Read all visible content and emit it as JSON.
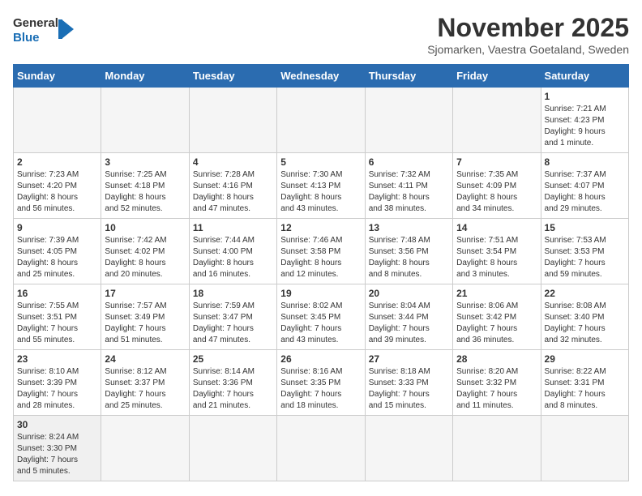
{
  "header": {
    "logo_general": "General",
    "logo_blue": "Blue",
    "month_title": "November 2025",
    "subtitle": "Sjomarken, Vaestra Goetaland, Sweden"
  },
  "weekdays": [
    "Sunday",
    "Monday",
    "Tuesday",
    "Wednesday",
    "Thursday",
    "Friday",
    "Saturday"
  ],
  "days": [
    {
      "day": "",
      "info": ""
    },
    {
      "day": "",
      "info": ""
    },
    {
      "day": "",
      "info": ""
    },
    {
      "day": "",
      "info": ""
    },
    {
      "day": "",
      "info": ""
    },
    {
      "day": "",
      "info": ""
    },
    {
      "day": "1",
      "info": "Sunrise: 7:21 AM\nSunset: 4:23 PM\nDaylight: 9 hours\nand 1 minute."
    },
    {
      "day": "2",
      "info": "Sunrise: 7:23 AM\nSunset: 4:20 PM\nDaylight: 8 hours\nand 56 minutes."
    },
    {
      "day": "3",
      "info": "Sunrise: 7:25 AM\nSunset: 4:18 PM\nDaylight: 8 hours\nand 52 minutes."
    },
    {
      "day": "4",
      "info": "Sunrise: 7:28 AM\nSunset: 4:16 PM\nDaylight: 8 hours\nand 47 minutes."
    },
    {
      "day": "5",
      "info": "Sunrise: 7:30 AM\nSunset: 4:13 PM\nDaylight: 8 hours\nand 43 minutes."
    },
    {
      "day": "6",
      "info": "Sunrise: 7:32 AM\nSunset: 4:11 PM\nDaylight: 8 hours\nand 38 minutes."
    },
    {
      "day": "7",
      "info": "Sunrise: 7:35 AM\nSunset: 4:09 PM\nDaylight: 8 hours\nand 34 minutes."
    },
    {
      "day": "8",
      "info": "Sunrise: 7:37 AM\nSunset: 4:07 PM\nDaylight: 8 hours\nand 29 minutes."
    },
    {
      "day": "9",
      "info": "Sunrise: 7:39 AM\nSunset: 4:05 PM\nDaylight: 8 hours\nand 25 minutes."
    },
    {
      "day": "10",
      "info": "Sunrise: 7:42 AM\nSunset: 4:02 PM\nDaylight: 8 hours\nand 20 minutes."
    },
    {
      "day": "11",
      "info": "Sunrise: 7:44 AM\nSunset: 4:00 PM\nDaylight: 8 hours\nand 16 minutes."
    },
    {
      "day": "12",
      "info": "Sunrise: 7:46 AM\nSunset: 3:58 PM\nDaylight: 8 hours\nand 12 minutes."
    },
    {
      "day": "13",
      "info": "Sunrise: 7:48 AM\nSunset: 3:56 PM\nDaylight: 8 hours\nand 8 minutes."
    },
    {
      "day": "14",
      "info": "Sunrise: 7:51 AM\nSunset: 3:54 PM\nDaylight: 8 hours\nand 3 minutes."
    },
    {
      "day": "15",
      "info": "Sunrise: 7:53 AM\nSunset: 3:53 PM\nDaylight: 7 hours\nand 59 minutes."
    },
    {
      "day": "16",
      "info": "Sunrise: 7:55 AM\nSunset: 3:51 PM\nDaylight: 7 hours\nand 55 minutes."
    },
    {
      "day": "17",
      "info": "Sunrise: 7:57 AM\nSunset: 3:49 PM\nDaylight: 7 hours\nand 51 minutes."
    },
    {
      "day": "18",
      "info": "Sunrise: 7:59 AM\nSunset: 3:47 PM\nDaylight: 7 hours\nand 47 minutes."
    },
    {
      "day": "19",
      "info": "Sunrise: 8:02 AM\nSunset: 3:45 PM\nDaylight: 7 hours\nand 43 minutes."
    },
    {
      "day": "20",
      "info": "Sunrise: 8:04 AM\nSunset: 3:44 PM\nDaylight: 7 hours\nand 39 minutes."
    },
    {
      "day": "21",
      "info": "Sunrise: 8:06 AM\nSunset: 3:42 PM\nDaylight: 7 hours\nand 36 minutes."
    },
    {
      "day": "22",
      "info": "Sunrise: 8:08 AM\nSunset: 3:40 PM\nDaylight: 7 hours\nand 32 minutes."
    },
    {
      "day": "23",
      "info": "Sunrise: 8:10 AM\nSunset: 3:39 PM\nDaylight: 7 hours\nand 28 minutes."
    },
    {
      "day": "24",
      "info": "Sunrise: 8:12 AM\nSunset: 3:37 PM\nDaylight: 7 hours\nand 25 minutes."
    },
    {
      "day": "25",
      "info": "Sunrise: 8:14 AM\nSunset: 3:36 PM\nDaylight: 7 hours\nand 21 minutes."
    },
    {
      "day": "26",
      "info": "Sunrise: 8:16 AM\nSunset: 3:35 PM\nDaylight: 7 hours\nand 18 minutes."
    },
    {
      "day": "27",
      "info": "Sunrise: 8:18 AM\nSunset: 3:33 PM\nDaylight: 7 hours\nand 15 minutes."
    },
    {
      "day": "28",
      "info": "Sunrise: 8:20 AM\nSunset: 3:32 PM\nDaylight: 7 hours\nand 11 minutes."
    },
    {
      "day": "29",
      "info": "Sunrise: 8:22 AM\nSunset: 3:31 PM\nDaylight: 7 hours\nand 8 minutes."
    },
    {
      "day": "30",
      "info": "Sunrise: 8:24 AM\nSunset: 3:30 PM\nDaylight: 7 hours\nand 5 minutes."
    },
    {
      "day": "",
      "info": ""
    },
    {
      "day": "",
      "info": ""
    },
    {
      "day": "",
      "info": ""
    },
    {
      "day": "",
      "info": ""
    },
    {
      "day": "",
      "info": ""
    },
    {
      "day": "",
      "info": ""
    }
  ]
}
